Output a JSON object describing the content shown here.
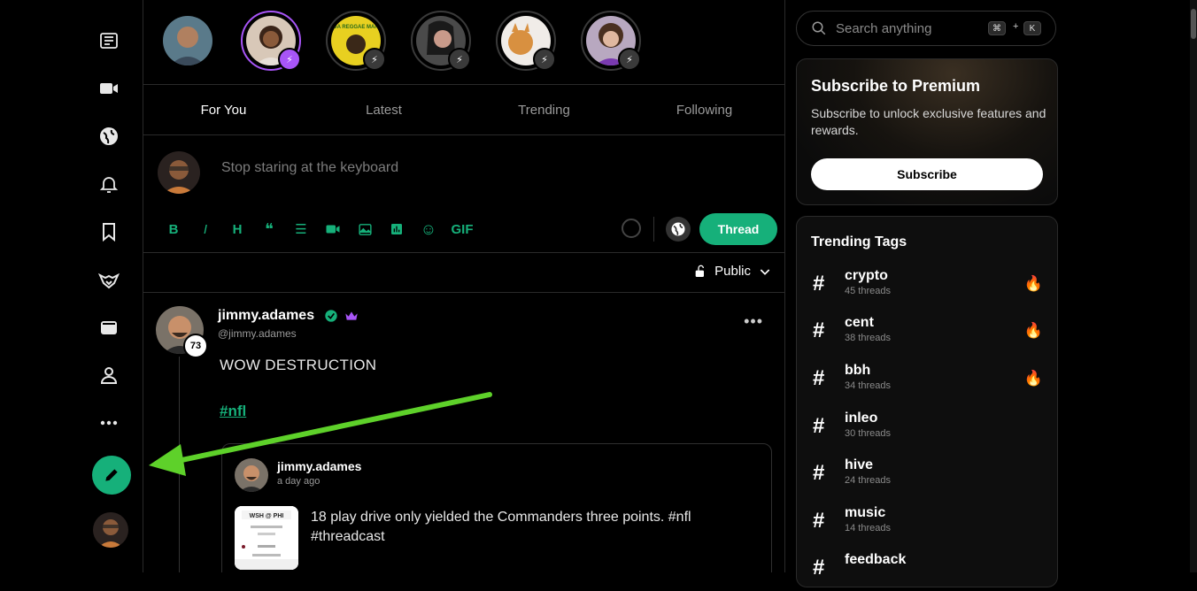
{
  "nav": {
    "items": [
      {
        "name": "news-icon"
      },
      {
        "name": "video-icon"
      },
      {
        "name": "globe-icon"
      },
      {
        "name": "bell-icon"
      },
      {
        "name": "bookmark-icon"
      },
      {
        "name": "fox-icon"
      },
      {
        "name": "wallet-icon"
      },
      {
        "name": "profile-icon"
      },
      {
        "name": "more-icon"
      }
    ],
    "compose_icon": "pencil-icon"
  },
  "stories": [
    {
      "initials": "",
      "color": "#4a6a7a"
    },
    {
      "initials": "",
      "color": "#8a5a3a"
    },
    {
      "initials": "DA REGGAE MAN",
      "color": "#e8d020"
    },
    {
      "initials": "",
      "color": "#6a4a5a"
    },
    {
      "initials": "",
      "color": "#d09040"
    },
    {
      "initials": "",
      "color": "#9a7aa0"
    }
  ],
  "tabs": [
    {
      "label": "For You",
      "active": true
    },
    {
      "label": "Latest",
      "active": false
    },
    {
      "label": "Trending",
      "active": false
    },
    {
      "label": "Following",
      "active": false
    }
  ],
  "composer": {
    "placeholder": "Stop staring at the keyboard",
    "tools": [
      "B",
      "I",
      "H",
      "❝",
      "☰",
      "video",
      "image",
      "chart",
      "☺"
    ],
    "gif_label": "GIF",
    "thread_label": "Thread"
  },
  "filter": {
    "visibility_label": "Public"
  },
  "post": {
    "author": "jimmy.adames",
    "handle": "@jimmy.adames",
    "level": "73",
    "text": "WOW DESTRUCTION",
    "hashtag": "#nfl",
    "quote": {
      "author": "jimmy.adames",
      "time": "a day ago",
      "text": "18 play drive only yielded the Commanders three points. #nfl #threadcast",
      "thumb_caption": "WSH @ PHI"
    }
  },
  "search": {
    "placeholder": "Search anything",
    "shortcut_mod": "⌘",
    "shortcut_plus": "+",
    "shortcut_key": "K"
  },
  "premium": {
    "title": "Subscribe to Premium",
    "description": "Subscribe to unlock exclusive features and rewards.",
    "button_label": "Subscribe"
  },
  "trending": {
    "title": "Trending Tags",
    "tags": [
      {
        "name": "crypto",
        "count": "45 threads",
        "hot": true
      },
      {
        "name": "cent",
        "count": "38 threads",
        "hot": true
      },
      {
        "name": "bbh",
        "count": "34 threads",
        "hot": true
      },
      {
        "name": "inleo",
        "count": "30 threads",
        "hot": false
      },
      {
        "name": "hive",
        "count": "24 threads",
        "hot": false
      },
      {
        "name": "music",
        "count": "14 threads",
        "hot": false
      },
      {
        "name": "feedback",
        "count": "",
        "hot": false
      }
    ]
  },
  "colors": {
    "accent": "#16b07a",
    "premium_purple": "#a855f7",
    "arrow": "#5ed12a"
  }
}
